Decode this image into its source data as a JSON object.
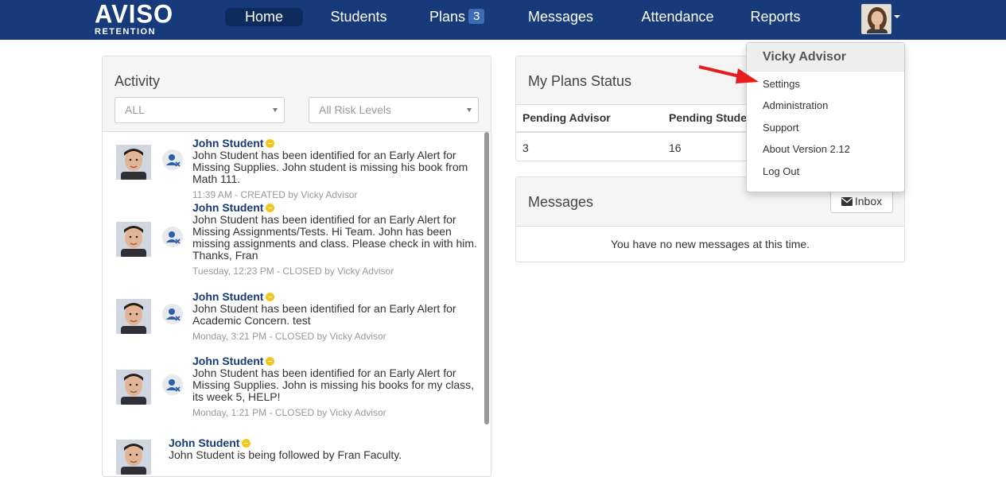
{
  "app": {
    "logo_main": "AVISO",
    "logo_sub": "RETENTION"
  },
  "nav": {
    "home": "Home",
    "students": "Students",
    "plans": "Plans",
    "plans_count": "3",
    "messages": "Messages",
    "attendance": "Attendance",
    "reports": "Reports"
  },
  "user_menu": {
    "name": "Vicky Advisor",
    "items": [
      "Settings",
      "Administration",
      "Support",
      "About Version 2.12",
      "Log Out"
    ]
  },
  "activity": {
    "title": "Activity",
    "filter_value": "ALL",
    "risk_value": "All Risk Levels",
    "items": [
      {
        "name": "John Student",
        "text": "John Student has been identified for an Early Alert for Missing Supplies. John student is missing his book from Math 111.",
        "meta": "11:39 AM - CREATED by Vicky Advisor"
      },
      {
        "name": "John Student",
        "text": "John Student has been identified for an Early Alert for Missing Assignments/Tests. Hi Team. John has been missing assignments and class. Please check in with him. Thanks, Fran",
        "meta": "Tuesday, 12:23 PM - CLOSED by Vicky Advisor"
      },
      {
        "name": "John Student",
        "text": "John Student has been identified for an Early Alert for Academic Concern. test",
        "meta": "Monday, 3:21 PM - CLOSED by Vicky Advisor"
      },
      {
        "name": "John Student",
        "text": "John Student has been identified for an Early Alert for Missing Supplies. John is missing his books for my class, its week 5, HELP!",
        "meta": "Monday, 1:21 PM - CLOSED by Vicky Advisor"
      },
      {
        "name": "John Student",
        "text": "John Student is being followed by Fran Faculty.",
        "meta": ""
      }
    ]
  },
  "plans_status": {
    "title": "My Plans Status",
    "headers": [
      "Pending Advisor",
      "Pending Studen"
    ],
    "values": [
      "3",
      "16"
    ]
  },
  "messages_panel": {
    "title": "Messages",
    "inbox_label": "Inbox",
    "empty_text": "You have no new messages at this time."
  },
  "colors": {
    "navbar": "#163a7a",
    "link": "#163a7a",
    "alert_dot": "#f5c518",
    "arrow": "#e81c1c"
  }
}
